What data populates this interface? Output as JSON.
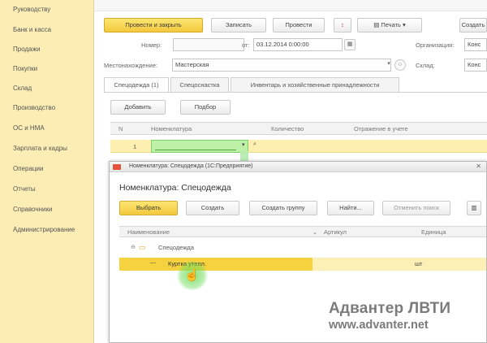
{
  "sidebar": {
    "items": [
      {
        "label": "Руководству"
      },
      {
        "label": "Банк и касса"
      },
      {
        "label": "Продажи"
      },
      {
        "label": "Покупки"
      },
      {
        "label": "Склад"
      },
      {
        "label": "Производство"
      },
      {
        "label": "ОС и НМА"
      },
      {
        "label": "Зарплата и кадры"
      },
      {
        "label": "Операции"
      },
      {
        "label": "Отчеты"
      },
      {
        "label": "Справочники"
      },
      {
        "label": "Администрирование"
      }
    ]
  },
  "toolbar": {
    "post_and_close": "Провести и закрыть",
    "save": "Записать",
    "post": "Провести",
    "print": "Печать",
    "create_based_on": "Создать"
  },
  "header": {
    "number_label": "Номер:",
    "date_from_label": "от:",
    "date_value": "03.12.2014 0:00:00",
    "organization_label": "Организация:",
    "organization_value": "Конс",
    "location_label": "Местонахождение:",
    "location_value": "Мастерская",
    "warehouse_label": "Склад:",
    "warehouse_value": "Конс"
  },
  "tabs": [
    {
      "label": "Спецодежда (1)"
    },
    {
      "label": "Спецоснастка"
    },
    {
      "label": "Инвентарь и хозяйственные принадлежности"
    }
  ],
  "table_toolbar": {
    "add": "Добавить",
    "pick": "Подбор"
  },
  "table": {
    "columns": [
      "N",
      "Номенклатура",
      "Количество",
      "Отражение в учете"
    ],
    "rows": [
      {
        "n": "1"
      }
    ]
  },
  "dialog": {
    "title": "Номенклатура: Спецодежда (1С:Предприятие)",
    "heading": "Номенклатура: Спецодежда",
    "buttons": {
      "select": "Выбрать",
      "create": "Создать",
      "create_group": "Создать группу",
      "find": "Найти...",
      "cancel_search": "Отменить поиск"
    },
    "columns": [
      "Наименование",
      "Артикул",
      "Единица"
    ],
    "group_label": "Спецодежда",
    "item_label": "Куртка утепл.",
    "item_unit": "шт"
  },
  "watermark": {
    "line1": "Адвантер ЛВТИ",
    "line2": "www.advanter.net"
  },
  "colors": {
    "accent_yellow": "#f7d23f",
    "sidebar_bg": "#fbedb4",
    "highlight_green": "#bff0a8"
  }
}
